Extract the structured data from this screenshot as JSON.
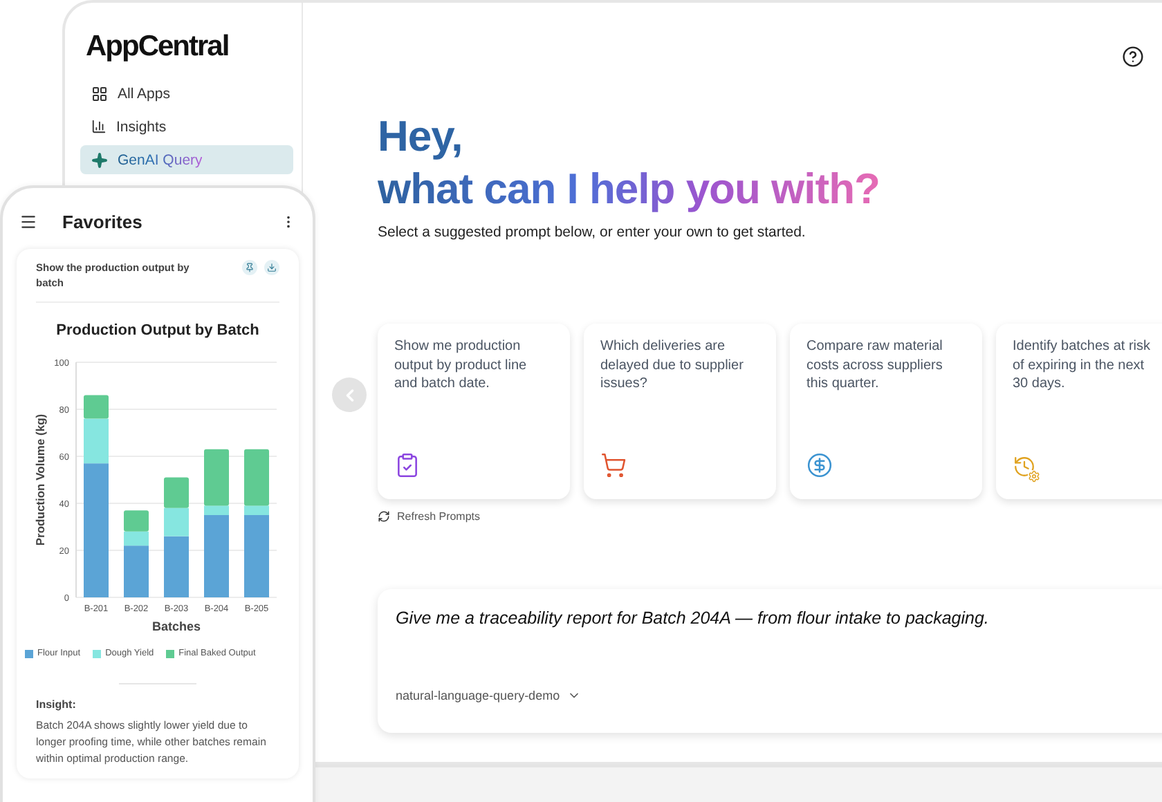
{
  "sidebar": {
    "logo": "AppCentral",
    "items": [
      {
        "label": "All Apps",
        "selected": false
      },
      {
        "label": "Insights",
        "selected": false
      },
      {
        "label": "GenAI Query",
        "selected": true
      }
    ]
  },
  "header": {
    "greeting": "Hey,",
    "headline": "what can I help you with?",
    "subtitle": "Select a suggested prompt below, or enter your own to get started."
  },
  "prompts": [
    {
      "text": "Show me production output by product line and batch date.",
      "kind": "clipboard",
      "color": "#8b45e0"
    },
    {
      "text": "Which deliveries are delayed due to supplier issues?",
      "kind": "cart",
      "color": "#e0542f"
    },
    {
      "text": "Compare raw material costs across suppliers this quarter.",
      "kind": "dollar",
      "color": "#3b93d1"
    },
    {
      "text": "Identify batches at risk of expiring in the next 30 days.",
      "kind": "history",
      "color": "#e0a21f"
    }
  ],
  "refresh": "Refresh Prompts",
  "query": {
    "value": "Give me a traceability report for Batch 204A — from flour intake to packaging.",
    "model": "natural-language-query-demo"
  },
  "phone": {
    "title": "Favorites",
    "card": {
      "prompt": "Show the production output by batch",
      "chart_data": {
        "type": "bar",
        "title": "Production Output by Batch",
        "xlabel": "Batches",
        "ylabel": "Production Volume (kg)",
        "categories": [
          "B-201",
          "B-202",
          "B-203",
          "B-204",
          "B-205"
        ],
        "stacked": true,
        "grid": true,
        "ylim": [
          0,
          100
        ],
        "yticks": [
          0,
          20,
          40,
          60,
          80,
          100
        ],
        "series": [
          {
            "name": "Flour Input",
            "color": "#5ba4d6",
            "values": [
              57,
              22,
              26,
              35,
              35
            ]
          },
          {
            "name": "Dough Yield",
            "color": "#86e6e0",
            "values": [
              19,
              6,
              12,
              4,
              4
            ]
          },
          {
            "name": "Final Baked Output",
            "color": "#5fcb92",
            "values": [
              10,
              9,
              13,
              24,
              24
            ]
          }
        ]
      }
    },
    "insight": {
      "label": "Insight:",
      "text": "Batch 204A shows slightly lower yield due to longer proofing time, while other batches remain within optimal production range."
    }
  }
}
